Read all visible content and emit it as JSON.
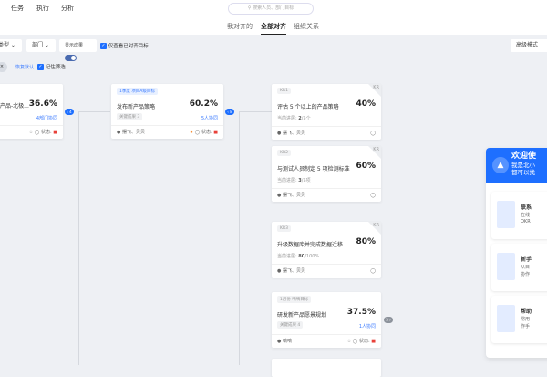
{
  "nav": {
    "items": [
      "任务",
      "执行",
      "分析"
    ],
    "search_placeholder": "搜索人员、部门目标"
  },
  "tabs": [
    "我对齐的",
    "全部对齐",
    "组织关系"
  ],
  "active_tab": "全部对齐",
  "filters": {
    "type": "类型",
    "dept": "部门",
    "show_results": "显示成果",
    "only_aligned": "仅查看已对齐目标",
    "advanced": "高级模式",
    "restore": "恢复默认",
    "remember": "记住筛选"
  },
  "colors": {
    "accent": "#1e6fff",
    "danger": "#e8413a",
    "star": "#f5821f"
  },
  "cards": [
    {
      "title": "产品-北极...",
      "pct": "36.6%",
      "link": "4部门协同",
      "status": "状态:"
    },
    {
      "tag": "1季度 项目A级目标",
      "title": "发布新产品策略",
      "pct": "60.2%",
      "sub": "关键成果 3",
      "link": "5人协同",
      "owner": "摆飞、贝贝",
      "status": "状态:",
      "connector": "8"
    }
  ],
  "krs": [
    {
      "tag": "KR1",
      "title": "评估 5 个以上的产品策略",
      "pct": "40%",
      "progress_label": "当前进展:",
      "progress": "2",
      "total": "/5个",
      "owner": "摆飞、贝贝",
      "badge": "KR"
    },
    {
      "tag": "KR2",
      "title": "与测试人员制定 5 项检测标准",
      "pct": "60%",
      "progress_label": "当前进展:",
      "progress": "3",
      "total": "/5项",
      "owner": "摆飞、贝贝",
      "badge": "KR"
    },
    {
      "tag": "KR3",
      "title": "升级数据库并完成数据迁移",
      "pct": "80%",
      "progress_label": "当前进展:",
      "progress": "80",
      "total": "/100%",
      "owner": "摆飞、贝贝",
      "badge": "KR"
    }
  ],
  "goal": {
    "tag": "1月份 嘀嘀目标",
    "title": "研发新产品愿景规划",
    "pct": "37.5%",
    "sub": "关键成果 4",
    "link": "1人协同",
    "owner": "嘀嘀",
    "status": "状态:",
    "connector": "5"
  },
  "panel": {
    "title": "欢迎使",
    "desc1": "我是北小",
    "desc2": "都可以找",
    "items": [
      {
        "title": "联系",
        "l1": "在线",
        "l2": "OKR"
      },
      {
        "title": "新手",
        "l1": "从目",
        "l2": "协作"
      },
      {
        "title": "帮助",
        "l1": "常用",
        "l2": "作手"
      }
    ]
  }
}
